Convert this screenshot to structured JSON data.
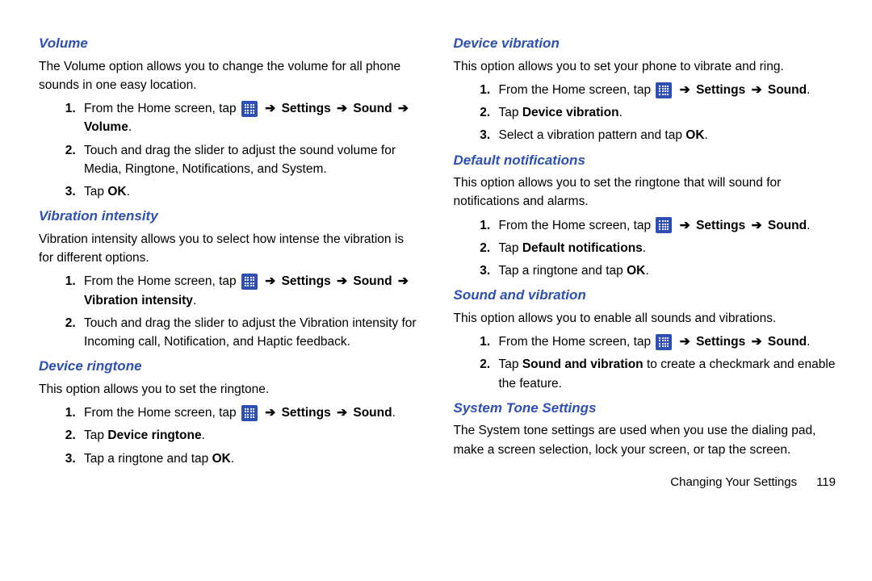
{
  "arrow": "➔",
  "left": {
    "s1": {
      "heading": "Volume",
      "intro": "The Volume option allows you to change the volume for all phone sounds in one easy location.",
      "step1_a": "From the Home screen, tap ",
      "step1_b": "Settings",
      "step1_c": "Sound",
      "step1_d": "Volume",
      "step2": "Touch and drag the slider to adjust the sound volume for Media, Ringtone, Notifications, and System.",
      "step3_a": "Tap ",
      "step3_b": "OK",
      "step3_c": "."
    },
    "s2": {
      "heading": "Vibration intensity",
      "intro": "Vibration intensity allows you to select how intense the vibration is for different options.",
      "step1_a": "From the Home screen, tap ",
      "step1_b": "Settings",
      "step1_c": "Sound",
      "step1_d": "Vibration intensity",
      "step2": "Touch and drag the slider to adjust the Vibration intensity for Incoming call, Notification, and Haptic feedback."
    },
    "s3": {
      "heading": "Device ringtone",
      "intro": "This option allows you to set the ringtone.",
      "step1_a": "From the Home screen, tap ",
      "step1_b": "Settings",
      "step1_c": "Sound",
      "step2_a": "Tap ",
      "step2_b": "Device ringtone",
      "step2_c": ".",
      "step3_a": "Tap a ringtone and tap ",
      "step3_b": "OK",
      "step3_c": "."
    }
  },
  "right": {
    "s1": {
      "heading": "Device vibration",
      "intro": "This option allows you to set your phone to vibrate and ring.",
      "step1_a": "From the Home screen, tap ",
      "step1_b": "Settings",
      "step1_c": "Sound",
      "step2_a": "Tap ",
      "step2_b": "Device vibration",
      "step2_c": ".",
      "step3_a": "Select a vibration pattern and tap ",
      "step3_b": "OK",
      "step3_c": "."
    },
    "s2": {
      "heading": "Default notifications",
      "intro": "This option allows you to set the ringtone that will sound for notifications and alarms.",
      "step1_a": "From the Home screen, tap ",
      "step1_b": "Settings",
      "step1_c": "Sound",
      "step2_a": "Tap ",
      "step2_b": "Default notifications",
      "step2_c": ".",
      "step3_a": "Tap a ringtone and tap ",
      "step3_b": "OK",
      "step3_c": "."
    },
    "s3": {
      "heading": "Sound and vibration",
      "intro": "This option allows you to enable all sounds and vibrations.",
      "step1_a": "From the Home screen, tap ",
      "step1_b": "Settings",
      "step1_c": "Sound",
      "step2_a": "Tap ",
      "step2_b": "Sound and vibration",
      "step2_c": " to create a checkmark and enable the feature."
    },
    "s4": {
      "heading": "System Tone Settings",
      "intro": "The System tone settings are used when you use the dialing pad, make a screen selection, lock your screen, or tap the screen."
    }
  },
  "footer": {
    "chapter": "Changing Your Settings",
    "page": "119"
  }
}
